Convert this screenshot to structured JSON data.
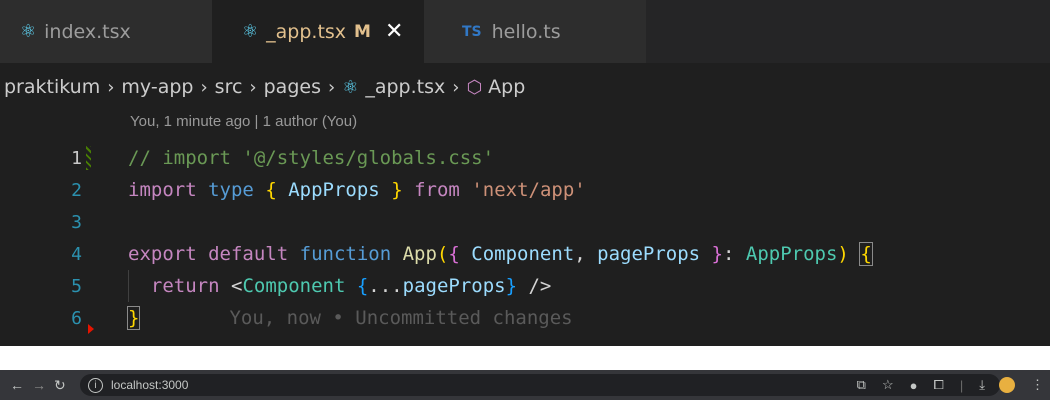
{
  "tabs": [
    {
      "label": "index.tsx",
      "icon": "react-icon"
    },
    {
      "label": "_app.tsx",
      "icon": "react-icon",
      "modified": "M",
      "active": true
    },
    {
      "label": "hello.ts",
      "icon": "typescript-icon",
      "badge": "TS"
    }
  ],
  "breadcrumb": [
    "praktikum",
    "my-app",
    "src",
    "pages",
    "_app.tsx",
    "App"
  ],
  "blame": {
    "top": "You, 1 minute ago | 1 author (You)",
    "inline": "You, now • Uncommitted changes"
  },
  "code": {
    "line_numbers": [
      "1",
      "2",
      "3",
      "4",
      "5",
      "6"
    ],
    "l1": "// import '@/styles/globals.css'",
    "l2": {
      "kw1": "import",
      "kw2": "type",
      "open": "{",
      "type": "AppProps",
      "close": "}",
      "kw3": "from",
      "str": "'next/app'"
    },
    "l4": {
      "kw1": "export",
      "kw2": "default",
      "kw3": "function",
      "fn": "App",
      "paren": "(",
      "open": "{",
      "p1": "Component",
      "comma": ",",
      "p2": "pageProps",
      "close": "}",
      "colon": ":",
      "type": "AppProps",
      "rparen": ")",
      "brace": "{"
    },
    "l5": {
      "kw": "return",
      "lt": "<",
      "comp": "Component",
      "open": "{",
      "spread": "...",
      "var": "pageProps",
      "close": "}",
      "end": " />"
    },
    "l6": {
      "brace": "}"
    }
  },
  "browser": {
    "url": "localhost:3000"
  },
  "colors": {
    "editor_bg": "#1f1f1f",
    "keyword": "#569cd6",
    "type": "#4ec9b0",
    "string": "#ce9178",
    "comment": "#6a9955"
  }
}
